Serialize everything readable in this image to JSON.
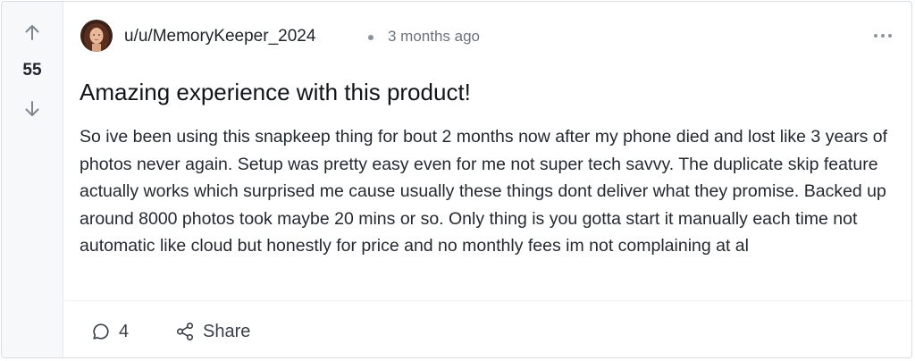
{
  "post": {
    "score": "55",
    "author": "u/u/MemoryKeeper_2024",
    "time": "3 months ago",
    "title": "Amazing experience with this product!",
    "body": "So ive been using this snapkeep thing for bout 2 months now after my phone died and lost like 3 years of photos never again. Setup was pretty easy even for me not super tech savvy. The duplicate skip feature actually works which surprised me cause usually these things dont deliver what they promise. Backed up around 8000 photos took maybe 20 mins or so. Only thing is you gotta start it manually each time not automatic like cloud but honestly for price and no monthly fees im not complaining at al",
    "comment_count": "4",
    "share_label": "Share"
  },
  "icons": {
    "upvote": "arrow-up-icon",
    "downvote": "arrow-down-icon",
    "more": "more-horizontal-icon",
    "comment": "comment-bubble-icon",
    "share": "share-nodes-icon"
  }
}
